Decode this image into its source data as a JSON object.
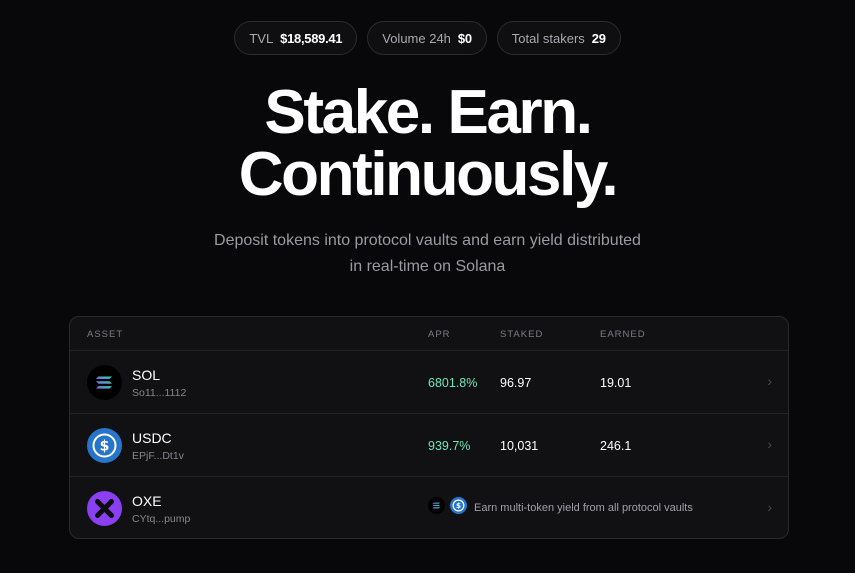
{
  "stats": [
    {
      "label": "TVL",
      "value": "$18,589.41"
    },
    {
      "label": "Volume 24h",
      "value": "$0"
    },
    {
      "label": "Total stakers",
      "value": "29"
    }
  ],
  "hero": {
    "line1": "Stake. Earn.",
    "line2": "Continuously.",
    "sub_line1": "Deposit tokens into protocol vaults and earn yield distributed",
    "sub_line2": "in real-time on Solana"
  },
  "table": {
    "headers": {
      "asset": "ASSET",
      "apr": "APR",
      "staked": "STAKED",
      "earned": "EARNED"
    },
    "rows": [
      {
        "name": "SOL",
        "address": "So11...1112",
        "apr": "6801.8%",
        "staked": "96.97",
        "earned": "19.01",
        "icon": "solana-icon"
      },
      {
        "name": "USDC",
        "address": "EPjF...Dt1v",
        "apr": "939.7%",
        "staked": "10,031",
        "earned": "246.1",
        "icon": "usdc-icon"
      },
      {
        "name": "OXE",
        "address": "CYtq...pump",
        "multi_text": "Earn multi-token yield from all protocol vaults",
        "icon": "oxe-icon"
      }
    ]
  },
  "colors": {
    "apr_green": "#6ee7b7",
    "usdc_blue": "#2775ca",
    "oxe_purple": "#8a3ff0",
    "background": "#08080a"
  }
}
